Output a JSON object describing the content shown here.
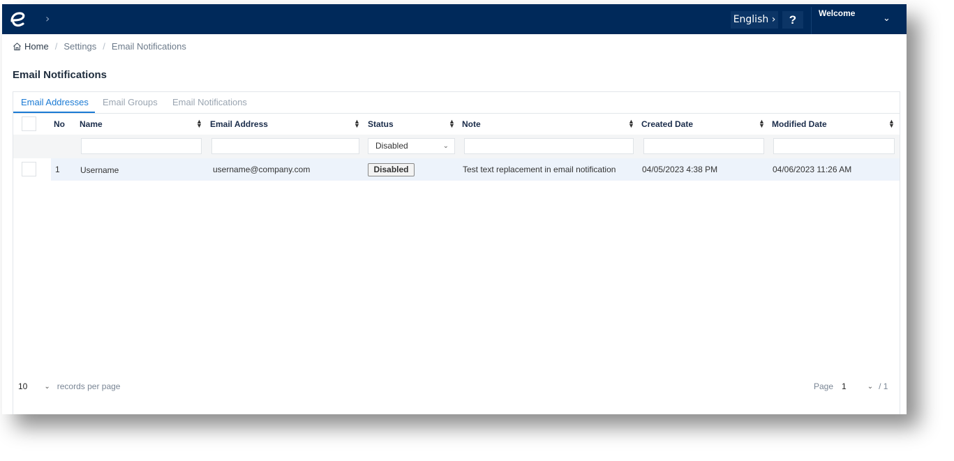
{
  "topbar": {
    "logo_icon": "brand-e-logo",
    "expand_icon": "chevron-right",
    "language_label": "English ›",
    "help_label": "?",
    "welcome_label": "Welcome",
    "user_menu_icon": "chevron-down"
  },
  "breadcrumb": {
    "items": [
      "Home",
      "Settings",
      "Email Notifications"
    ],
    "separator": "/"
  },
  "page": {
    "title": "Email Notifications"
  },
  "tabs": [
    {
      "label": "Email Addresses",
      "active": true
    },
    {
      "label": "Email Groups",
      "active": false
    },
    {
      "label": "Email Notifications",
      "active": false
    }
  ],
  "table": {
    "columns": [
      "No",
      "Name",
      "Email Address",
      "Status",
      "Note",
      "Created Date",
      "Modified Date"
    ],
    "filters": {
      "name": "",
      "email": "",
      "status": "Disabled",
      "note": "",
      "created": "",
      "modified": ""
    },
    "rows": [
      {
        "no": "1",
        "name": "Username",
        "email": "username@company.com",
        "status": "Disabled",
        "note": "Test text replacement in email notification",
        "created": "04/05/2023 4:38 PM",
        "modified": "04/06/2023 11:26 AM"
      }
    ]
  },
  "pagination": {
    "per_page": "10",
    "per_page_label": "records per page",
    "page_label": "Page",
    "current_page": "1",
    "total_pages": "/ 1"
  },
  "colors": {
    "header_bg": "#00295a",
    "accent": "#1a7ad4",
    "row_highlight": "#edf3fb"
  }
}
